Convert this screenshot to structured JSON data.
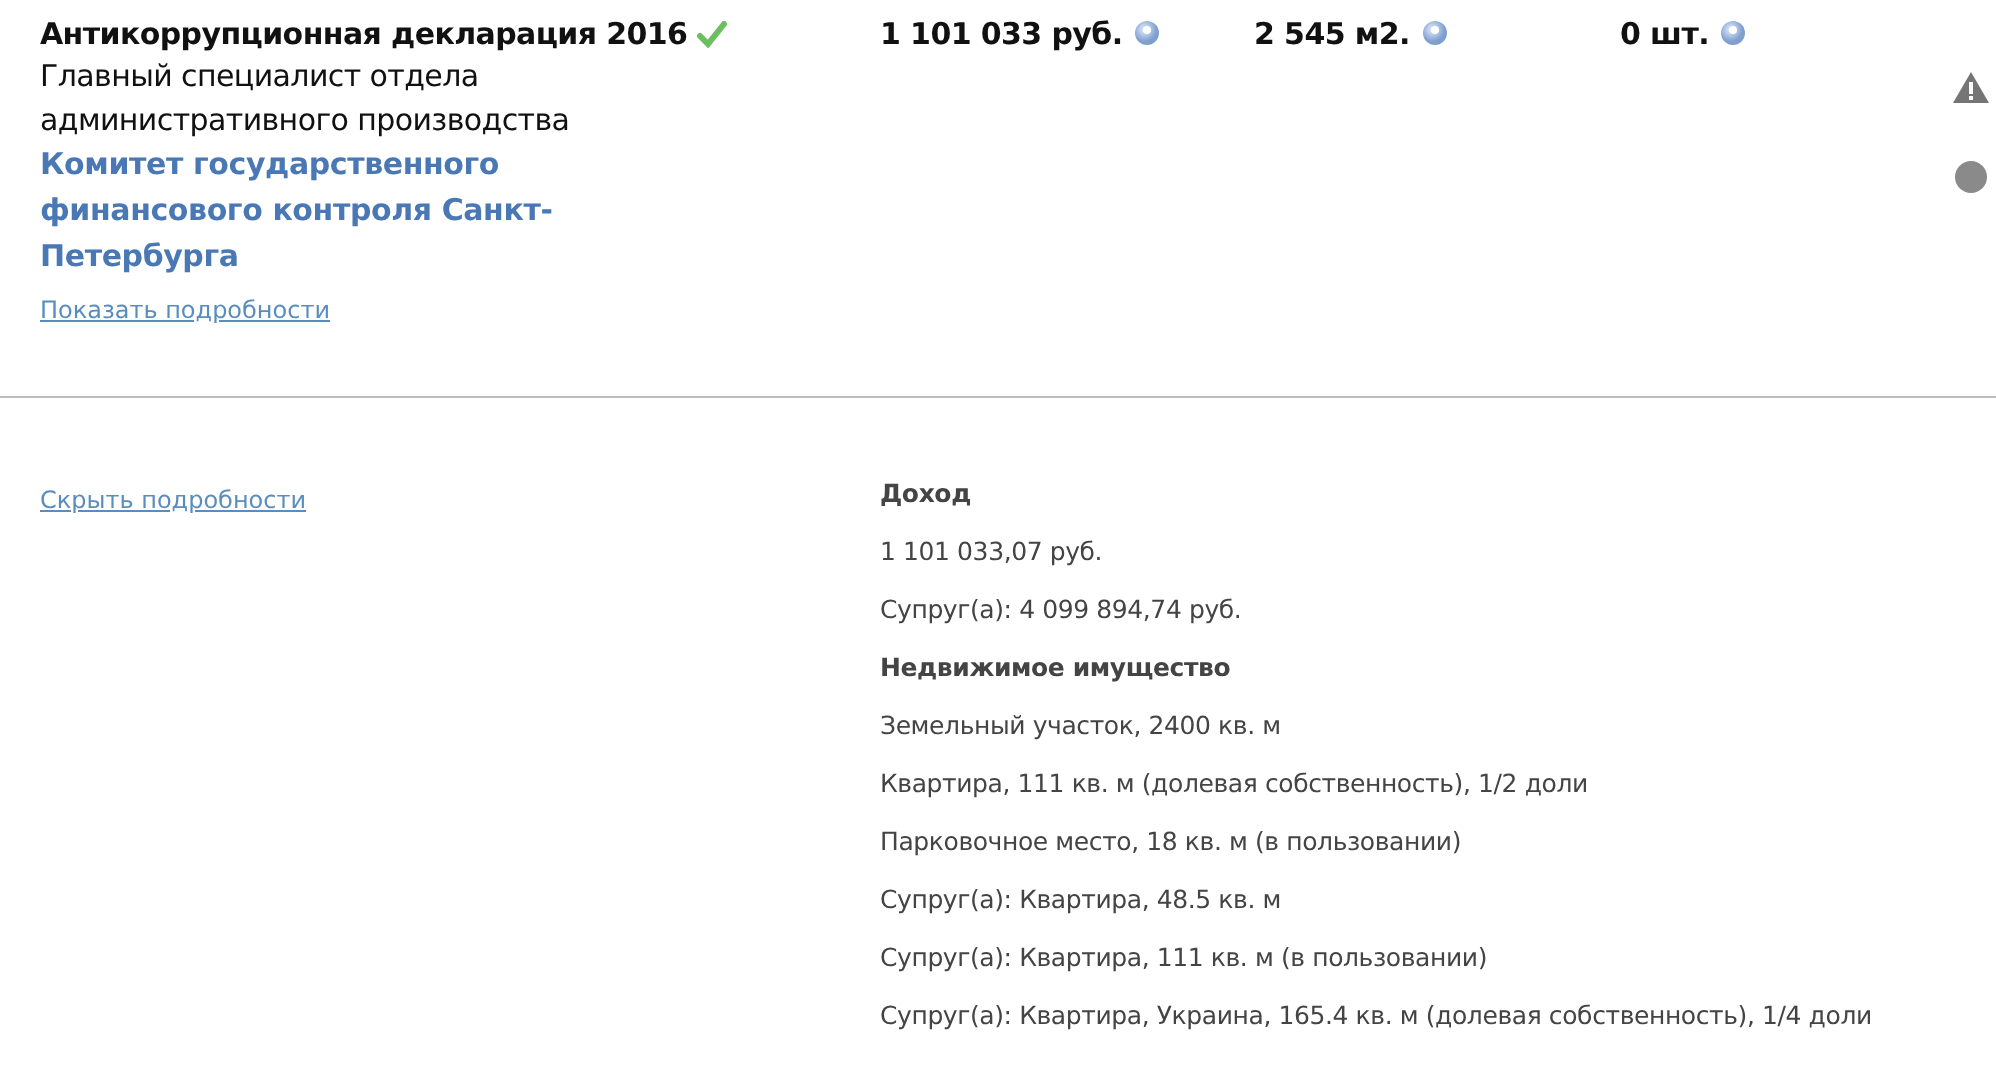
{
  "declaration": {
    "title": "Антикоррупционная декларация 2016",
    "verified": true,
    "position": "Главный специалист отдела административного производства",
    "organization": "Комитет государственного финансового контроля Санкт-Петербурга",
    "show_details_link": "Показать подробности",
    "stats": [
      {
        "value": "1 101 033 руб."
      },
      {
        "value": "2 545 м2."
      },
      {
        "value": "0 шт."
      }
    ]
  },
  "details": {
    "hide_details_link": "Скрыть подробности",
    "lines": [
      {
        "kind": "heading",
        "text": "Доход"
      },
      {
        "kind": "line",
        "text": "1 101 033,07 руб."
      },
      {
        "kind": "line",
        "text": "Супруг(а): 4 099 894,74 руб."
      },
      {
        "kind": "heading",
        "text": "Недвижимое имущество"
      },
      {
        "kind": "line",
        "text": "Земельный участок, 2400 кв. м"
      },
      {
        "kind": "line",
        "text": "Квартира, 111 кв. м (долевая собственность), 1/2 доли"
      },
      {
        "kind": "line",
        "text": "Парковочное место, 18 кв. м (в пользовании)"
      },
      {
        "kind": "line",
        "text": "Супруг(а): Квартира, 48.5 кв. м"
      },
      {
        "kind": "line",
        "text": "Супруг(а): Квартира, 111 кв. м (в пользовании)"
      },
      {
        "kind": "line",
        "text": "Супруг(а): Квартира, Украина, 165.4 кв. м (долевая собственность), 1/4 доли"
      }
    ]
  }
}
